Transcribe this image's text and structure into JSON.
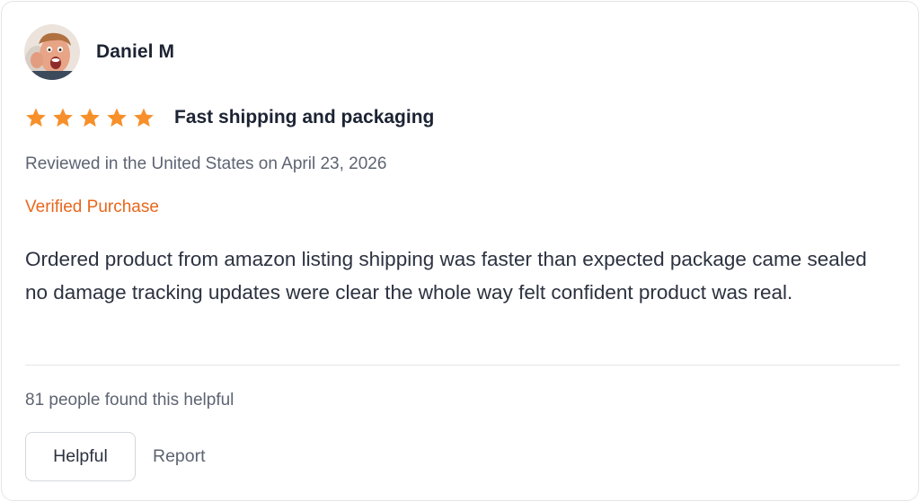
{
  "review": {
    "reviewer_name": "Daniel M",
    "avatar": "reviewer-photo",
    "rating": 5,
    "rating_max": 5,
    "star_color": "#f7902a",
    "title": "Fast shipping and packaging",
    "date_text": "Reviewed in the United States on April 23, 2026",
    "verified_label": "Verified Purchase",
    "verified_color": "#e8671c",
    "body": "Ordered product from amazon listing shipping was faster than expected package came sealed no damage tracking updates were clear the whole way felt confident product was real.",
    "helpful_count_text": "81 people found this helpful",
    "helpful_button_label": "Helpful",
    "report_label": "Report"
  }
}
